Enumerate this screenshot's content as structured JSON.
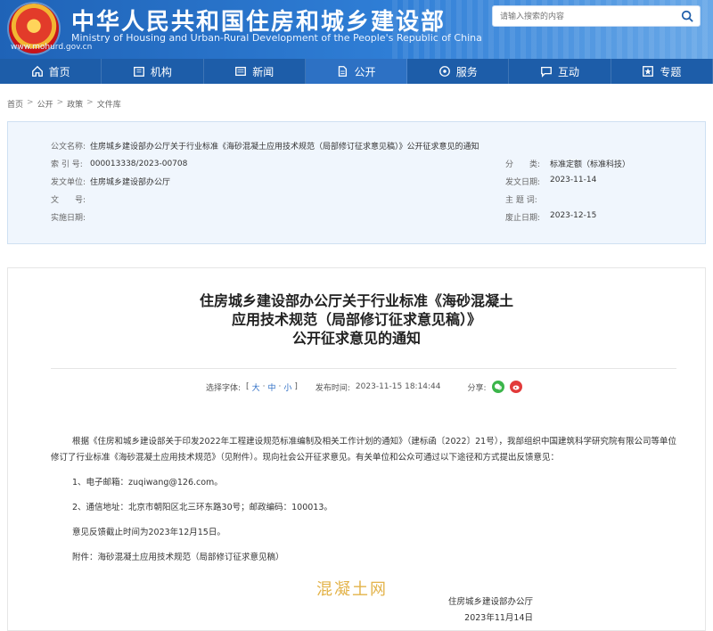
{
  "header": {
    "title": "中华人民共和国住房和城乡建设部",
    "subtitle": "Ministry of Housing and Urban-Rural Development of the People's Republic of China",
    "domain": "www.mohurd.gov.cn",
    "search_placeholder": "请输入搜索的内容",
    "colors": {
      "primary": "#1d5da9",
      "accent": "#2f7ed6"
    }
  },
  "nav": {
    "items": [
      {
        "label": "首页",
        "icon": "home-icon"
      },
      {
        "label": "机构",
        "icon": "building-icon"
      },
      {
        "label": "新闻",
        "icon": "newspaper-icon"
      },
      {
        "label": "公开",
        "icon": "document-icon",
        "active": true
      },
      {
        "label": "服务",
        "icon": "service-icon"
      },
      {
        "label": "互动",
        "icon": "chat-icon"
      },
      {
        "label": "专题",
        "icon": "star-icon"
      }
    ]
  },
  "breadcrumb": {
    "items": [
      "首页",
      "公开",
      "政策",
      "文件库"
    ],
    "separator": ">"
  },
  "meta": {
    "name_label": "公文名称:",
    "name_value": "住房城乡建设部办公厅关于行业标准《海砂混凝土应用技术规范（局部修订征求意见稿）》公开征求意见的通知",
    "index_label": "索 引 号:",
    "index_value": "000013338/2023-00708",
    "category_label": "分　　类:",
    "category_value": "标准定额（标准科技）",
    "issuer_label": "发文单位:",
    "issuer_value": "住房城乡建设部办公厅",
    "date_label": "发文日期:",
    "date_value": "2023-11-14",
    "docno_label": "文　　号:",
    "docno_value": "",
    "topic_label": "主 题 词:",
    "topic_value": "",
    "effective_label": "实施日期:",
    "effective_value": "",
    "expire_label": "废止日期:",
    "expire_value": "2023-12-15"
  },
  "article": {
    "title_line1": "住房城乡建设部办公厅关于行业标准《海砂混凝土",
    "title_line2": "应用技术规范（局部修订征求意见稿）》",
    "title_line3": "公开征求意见的通知",
    "font_label": "选择字体:",
    "font_open": "[",
    "font_large": "大",
    "font_dot1": "·",
    "font_medium": "中",
    "font_dot2": "·",
    "font_small": "小",
    "font_close": "]",
    "publish_label": "发布时间:",
    "publish_time": "2023-11-15 18:14:44",
    "share_label": "分享:",
    "share_icons": [
      "wechat-icon",
      "weibo-icon"
    ],
    "paragraph1": "根据《住房和城乡建设部关于印发2022年工程建设规范标准编制及相关工作计划的通知》（建标函〔2022〕21号），我部组织中国建筑科学研究院有限公司等单位修订了行业标准《海砂混凝土应用技术规范》（见附件）。现向社会公开征求意见。有关单位和公众可通过以下途径和方式提出反馈意见：",
    "item1": "1、电子邮箱：zuqiwang@126.com。",
    "item2": "2、通信地址：北京市朝阳区北三环东路30号；邮政编码：100013。",
    "deadline": "意见反馈截止时间为2023年12月15日。",
    "attachment": "附件：海砂混凝土应用技术规范（局部修订征求意见稿）",
    "watermark": "混凝土网",
    "signature_org": "住房城乡建设部办公厅",
    "signature_date": "2023年11月14日"
  }
}
